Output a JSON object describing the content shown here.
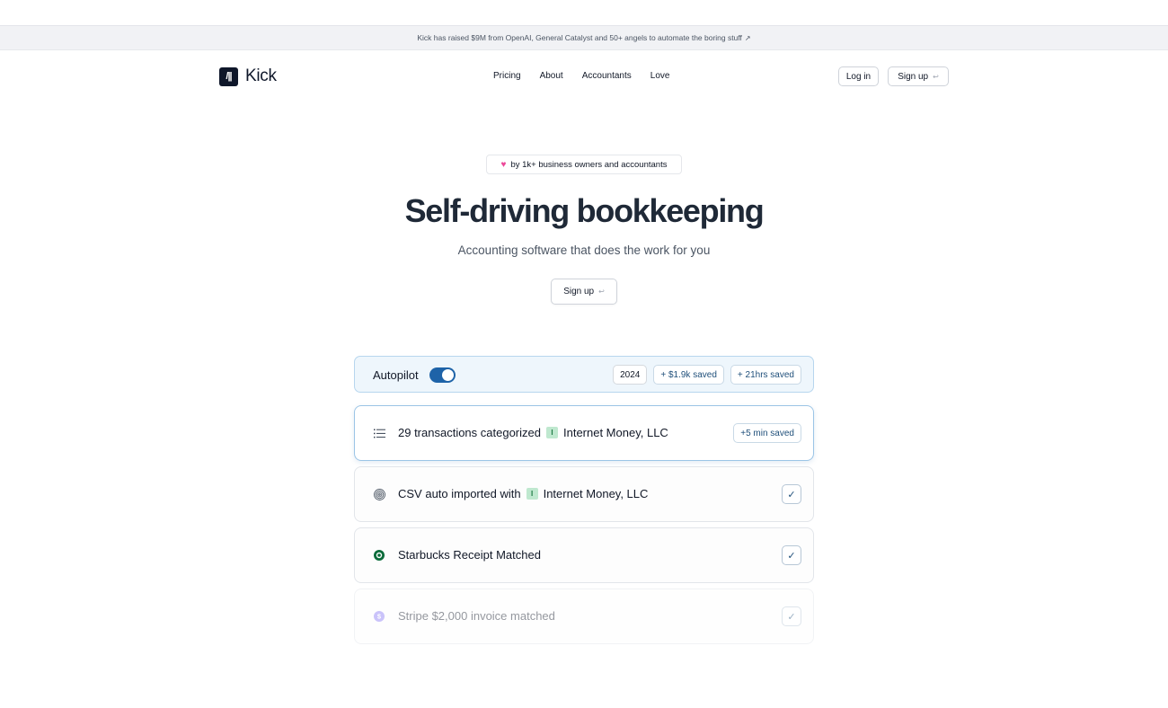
{
  "announcement": {
    "text": "Kick has raised $9M from OpenAI, General Catalyst and 50+ angels to automate the boring stuff",
    "arrow": "↗"
  },
  "nav": {
    "brand": "Kick",
    "logo_mark": "/||",
    "links": [
      "Pricing",
      "About",
      "Accountants",
      "Love"
    ],
    "login_label": "Log in",
    "signup_label": "Sign up",
    "enter_icon": "↩"
  },
  "hero": {
    "pill_text": "by 1k+ business owners and accountants",
    "title": "Self-driving bookkeeping",
    "subtitle": "Accounting software that does the work for you",
    "cta_label": "Sign up"
  },
  "demo": {
    "autopilot_label": "Autopilot",
    "autopilot_on": true,
    "badges": [
      "2024",
      "+ $1.9k saved",
      "+ 21hrs saved"
    ],
    "rows": [
      {
        "icon": "list-icon",
        "text_a": "29 transactions categorized",
        "entity_badge": "I",
        "text_b": "Internet Money, LLC",
        "right_badge": "+5 min saved",
        "state": "active"
      },
      {
        "icon": "fingerprint-icon",
        "text_a": "CSV auto imported with",
        "entity_badge": "I",
        "text_b": "Internet Money, LLC",
        "state": "done"
      },
      {
        "icon": "starbucks-icon",
        "text_a": "Starbucks Receipt Matched",
        "state": "done"
      },
      {
        "icon": "stripe-icon",
        "text_a": "Stripe $2,000 invoice matched",
        "state": "faded"
      }
    ],
    "check_glyph": "✓"
  },
  "colors": {
    "accent": "#1e63a8",
    "autopilot_bg": "#eef6fc",
    "heart": "#ec4899",
    "entity_badge": "#bfe8cf"
  }
}
